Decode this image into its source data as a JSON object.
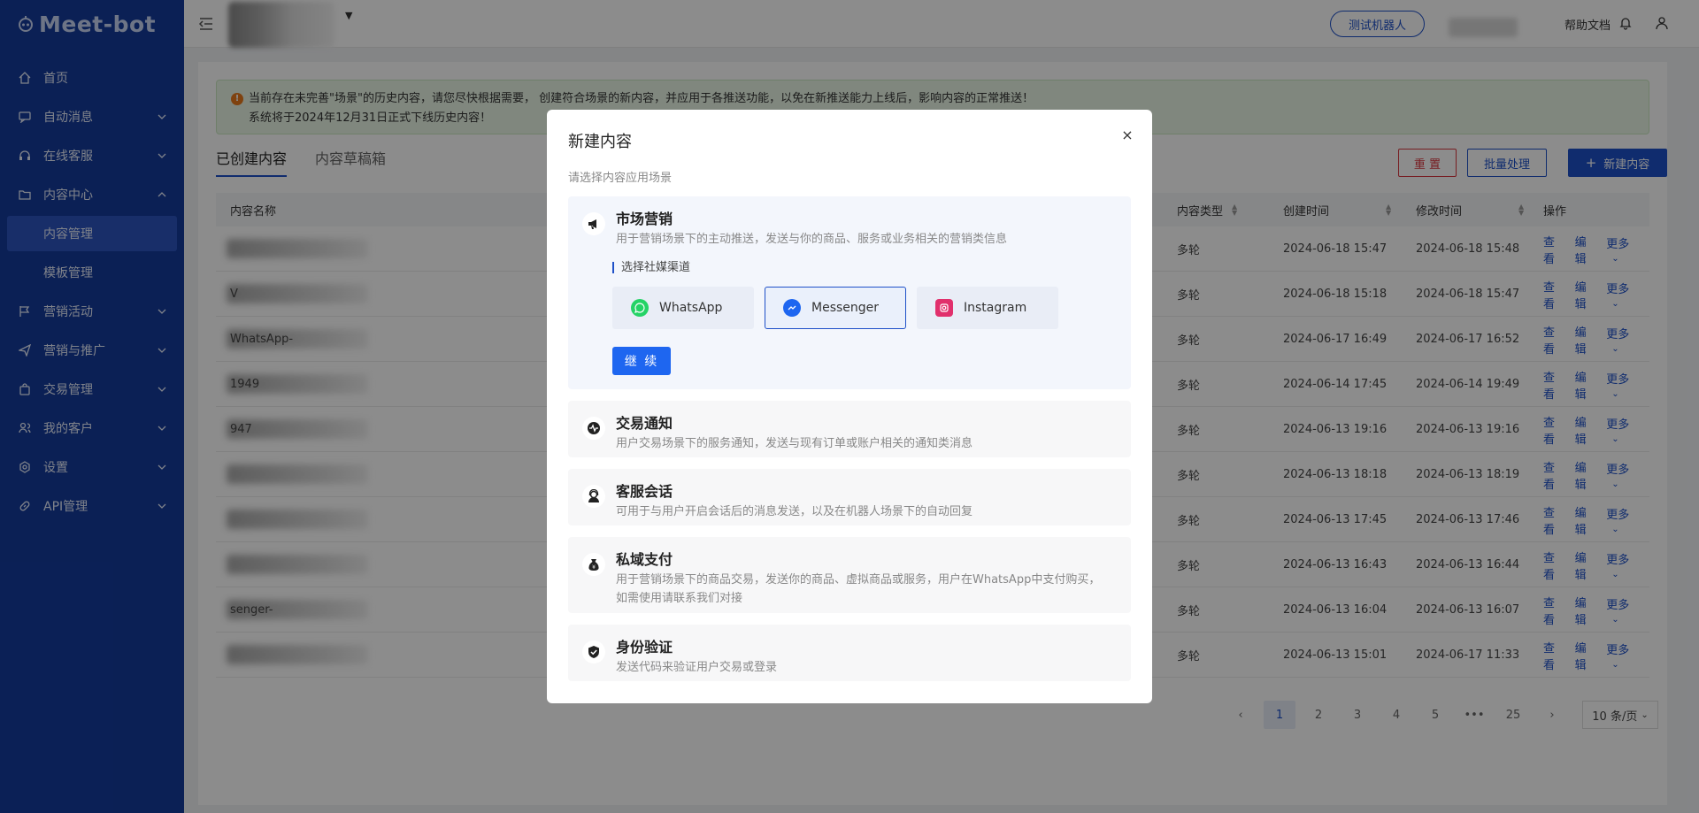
{
  "app": {
    "logo_text": "Meet-bot"
  },
  "sidebar": {
    "items": [
      {
        "label": "首页",
        "icon": "home-icon"
      },
      {
        "label": "自动消息",
        "icon": "message-icon"
      },
      {
        "label": "在线客服",
        "icon": "headset-icon"
      },
      {
        "label": "内容中心",
        "icon": "folder-icon"
      },
      {
        "label": "内容管理"
      },
      {
        "label": "模板管理"
      },
      {
        "label": "营销活动",
        "icon": "flag-icon"
      },
      {
        "label": "营销与推广",
        "icon": "send-icon"
      },
      {
        "label": "交易管理",
        "icon": "bag-icon"
      },
      {
        "label": "我的客户",
        "icon": "users-icon"
      },
      {
        "label": "设置",
        "icon": "gear-icon"
      },
      {
        "label": "API管理",
        "icon": "link-icon"
      }
    ]
  },
  "header": {
    "test_bot": "测试机器人",
    "help": "帮助文档"
  },
  "alert": {
    "line1": "当前存在未完善\"场景\"的历史内容，请您尽快根据需要， 创建符合场景的新内容，并应用于各推送功能，以免在新推送能力上线后，影响内容的正常推送！",
    "line2": "系统将于2024年12月31日正式下线历史内容！"
  },
  "tabs": [
    "已创建内容",
    "内容草稿箱"
  ],
  "toolbar": {
    "reset": "重 置",
    "batch": "批量处理",
    "new": "新建内容"
  },
  "table": {
    "headers": {
      "name": "内容名称",
      "type": "内容类型",
      "created": "创建时间",
      "modified": "修改时间",
      "actions": "操作"
    },
    "rows": [
      {
        "name": "",
        "type": "多轮",
        "created": "2024-06-18 15:47",
        "modified": "2024-06-18 15:48"
      },
      {
        "name": "V",
        "type": "多轮",
        "created": "2024-06-18 15:18",
        "modified": "2024-06-18 15:47"
      },
      {
        "name": "WhatsApp-",
        "type": "多轮",
        "created": "2024-06-17 16:49",
        "modified": "2024-06-17 16:52"
      },
      {
        "name": "1949",
        "type": "多轮",
        "created": "2024-06-14 17:45",
        "modified": "2024-06-14 19:49"
      },
      {
        "name": "947",
        "type": "多轮",
        "created": "2024-06-13 19:16",
        "modified": "2024-06-13 19:16"
      },
      {
        "name": "",
        "type": "多轮",
        "created": "2024-06-13 18:18",
        "modified": "2024-06-13 18:19"
      },
      {
        "name": "",
        "type": "多轮",
        "created": "2024-06-13 17:45",
        "modified": "2024-06-13 17:46"
      },
      {
        "name": "",
        "type": "多轮",
        "created": "2024-06-13 16:43",
        "modified": "2024-06-13 16:44"
      },
      {
        "name": "senger-",
        "type": "多轮",
        "created": "2024-06-13 16:04",
        "modified": "2024-06-13 16:07"
      },
      {
        "name": "",
        "type": "多轮",
        "created": "2024-06-13 15:01",
        "modified": "2024-06-17 11:33"
      }
    ],
    "actions": {
      "view": "查看",
      "edit": "编辑",
      "more": "更多"
    }
  },
  "pagination": {
    "pages": [
      "1",
      "2",
      "3",
      "4",
      "5",
      "•••",
      "25"
    ],
    "size": "10 条/页"
  },
  "modal": {
    "title": "新建内容",
    "close": "×",
    "subtitle": "请选择内容应用场景",
    "scenes": [
      {
        "title": "市场营销",
        "desc": "用于营销场景下的主动推送，发送与你的商品、服务或业务相关的营销类信息",
        "icon": "megaphone-icon"
      },
      {
        "title": "交易通知",
        "desc": "用户交易场景下的服务通知，发送与现有订单或账户相关的通知类消息",
        "icon": "pulse-icon"
      },
      {
        "title": "客服会话",
        "desc": "可用于与用户开启会话后的消息发送，以及在机器人场景下的自动回复",
        "icon": "agent-icon"
      },
      {
        "title": "私域支付",
        "desc": "用于营销场景下的商品交易，发送你的商品、虚拟商品或服务，用户在WhatsApp中支付购买，如需使用请联系我们对接",
        "icon": "moneybag-icon"
      },
      {
        "title": "身份验证",
        "desc": "发送代码来验证用户交易或登录",
        "icon": "shield-check-icon"
      }
    ],
    "channels_label": "选择社媒渠道",
    "channels": [
      {
        "label": "WhatsApp",
        "color": "#25d366"
      },
      {
        "label": "Messenger",
        "color": "#1e66f0"
      },
      {
        "label": "Instagram",
        "color": "#e1306c"
      }
    ],
    "selected_channel": "Messenger",
    "continue": "继 续"
  }
}
